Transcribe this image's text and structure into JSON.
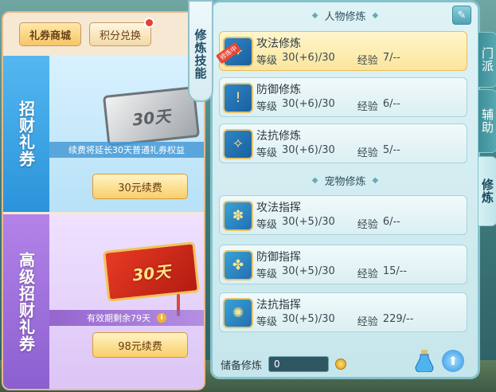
{
  "shop": {
    "tabs": [
      {
        "label": "礼券商城",
        "active": true
      },
      {
        "label": "积分兑换",
        "active": false,
        "badge": true
      }
    ],
    "cards": [
      {
        "title": "招财礼券",
        "ticket_text": "30天",
        "note": "续费将延长30天普通礼券权益",
        "button": "30元续费"
      },
      {
        "title": "高级招财礼券",
        "ticket_text": "30天",
        "note": "有效期剩余79天",
        "button": "98元续费"
      }
    ]
  },
  "cultivation": {
    "tab_label": "修炼技能",
    "character_section": "人物修炼",
    "pet_section": "宠物修炼",
    "level_label": "等级",
    "exp_label": "经验",
    "character_skills": [
      {
        "name": "攻法修炼",
        "level": "30(+6)/30",
        "exp": "7/--",
        "selected": true,
        "tag": "修炼中",
        "icon": "attack-magic-icon"
      },
      {
        "name": "防御修炼",
        "level": "30(+6)/30",
        "exp": "6/--",
        "selected": false,
        "icon": "defense-icon"
      },
      {
        "name": "法抗修炼",
        "level": "30(+6)/30",
        "exp": "5/--",
        "selected": false,
        "icon": "magic-resist-icon"
      }
    ],
    "pet_skills": [
      {
        "name": "攻法指挥",
        "level": "30(+5)/30",
        "exp": "6/--",
        "icon": "pet-attack-icon"
      },
      {
        "name": "防御指挥",
        "level": "30(+5)/30",
        "exp": "15/--",
        "icon": "pet-defense-icon"
      },
      {
        "name": "法抗指挥",
        "level": "30(+5)/30",
        "exp": "229/--",
        "icon": "pet-resist-icon"
      }
    ],
    "reserve_label": "储备修炼",
    "reserve_value": "0"
  },
  "side_tabs": [
    {
      "label": "门派",
      "active": false
    },
    {
      "label": "辅助",
      "active": false
    },
    {
      "label": "修炼",
      "active": true
    }
  ],
  "corner_label": "修炼"
}
